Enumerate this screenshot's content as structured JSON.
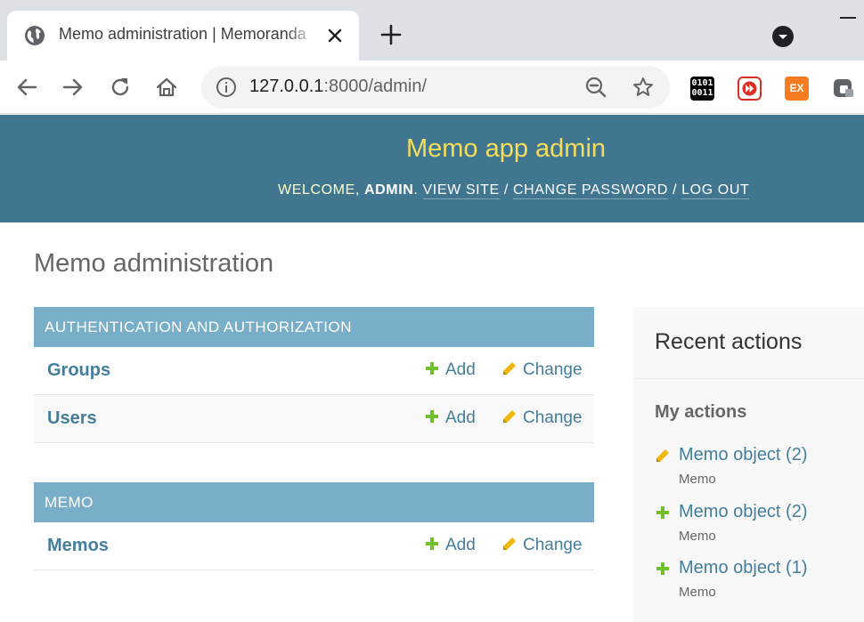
{
  "browser": {
    "tab_title": "Memo administration | Memoranda",
    "url_host": "127.0.0.1",
    "url_rest": ":8000/admin/",
    "extensions": {
      "binary_text_line1": "0101",
      "binary_text_line2": "0011",
      "ex_label": "EX"
    }
  },
  "header": {
    "branding": "Memo app admin",
    "welcome": "WELCOME,",
    "username": "ADMIN",
    "view_site": "VIEW SITE",
    "change_password": "CHANGE PASSWORD",
    "log_out": "LOG OUT",
    "separator": "/"
  },
  "content": {
    "title": "Memo administration",
    "modules": [
      {
        "caption": "AUTHENTICATION AND AUTHORIZATION",
        "rows": [
          {
            "name": "Groups",
            "add": "Add",
            "change": "Change"
          },
          {
            "name": "Users",
            "add": "Add",
            "change": "Change"
          }
        ]
      },
      {
        "caption": "MEMO",
        "rows": [
          {
            "name": "Memos",
            "add": "Add",
            "change": "Change"
          }
        ]
      }
    ]
  },
  "sidebar": {
    "title": "Recent actions",
    "subtitle": "My actions",
    "actions": [
      {
        "kind": "change",
        "label": "Memo object (2)",
        "type": "Memo"
      },
      {
        "kind": "add",
        "label": "Memo object (2)",
        "type": "Memo"
      },
      {
        "kind": "add",
        "label": "Memo object (1)",
        "type": "Memo"
      }
    ]
  },
  "colors": {
    "header_bg": "#417690",
    "branding": "#f5dd5d",
    "module_caption_bg": "#79aec8",
    "link": "#447e9b",
    "add_icon": "#70bf2b",
    "change_icon": "#efb80b"
  }
}
